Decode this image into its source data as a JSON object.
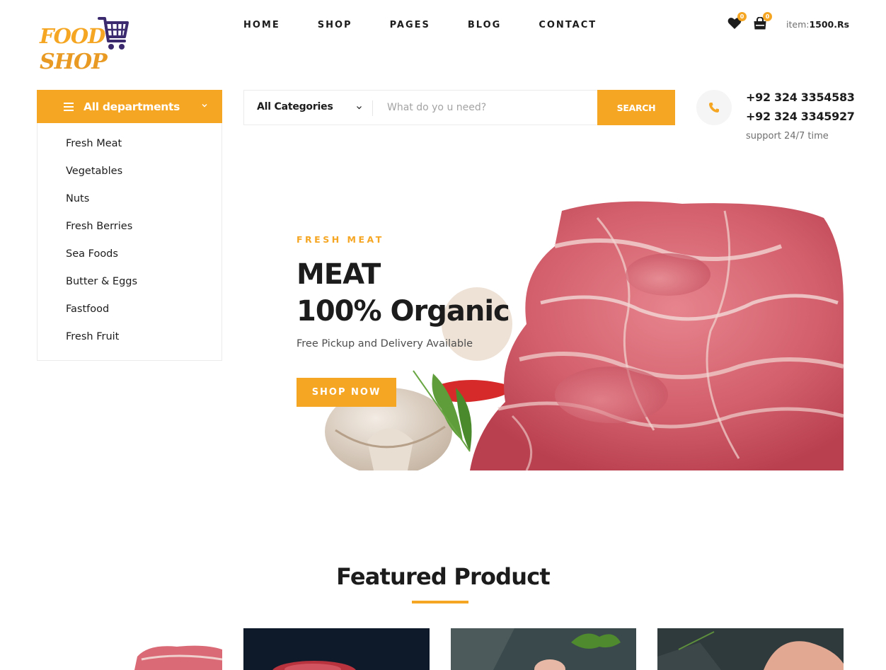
{
  "logo": {
    "line1": "FOOD",
    "line2": "SHOP"
  },
  "nav": [
    "HOME",
    "SHOP",
    "PAGES",
    "BLOG",
    "CONTACT"
  ],
  "header": {
    "wishlist_count": "0",
    "cart_count": "0",
    "total_label": "item:",
    "total_value": "1500.Rs"
  },
  "departments": {
    "title": "All departments",
    "items": [
      "Fresh Meat",
      "Vegetables",
      "Nuts",
      "Fresh Berries",
      "Sea Foods",
      "Butter & Eggs",
      "Fastfood",
      "Fresh Fruit"
    ]
  },
  "search": {
    "category": "All Categories",
    "placeholder": "What do yo u need?",
    "button": "SEARCH"
  },
  "contact": {
    "phone1": "+92 324 3354583",
    "phone2": "+92 324 3345927",
    "support": "support 24/7 time"
  },
  "hero": {
    "eyebrow": "FRESH MEAT",
    "title_line1": "MEAT",
    "title_line2": "100% Organic",
    "subtitle": "Free Pickup and Delivery Available",
    "button": "SHOP NOW"
  },
  "featured": {
    "title": "Featured Product"
  },
  "colors": {
    "accent": "#f5a623",
    "text": "#1c1c1c",
    "muted": "#6f6f6f"
  },
  "icons": [
    "menu-icon",
    "chevron-down-icon",
    "heart-icon",
    "shopping-bag-icon",
    "phone-icon",
    "cart-icon"
  ]
}
